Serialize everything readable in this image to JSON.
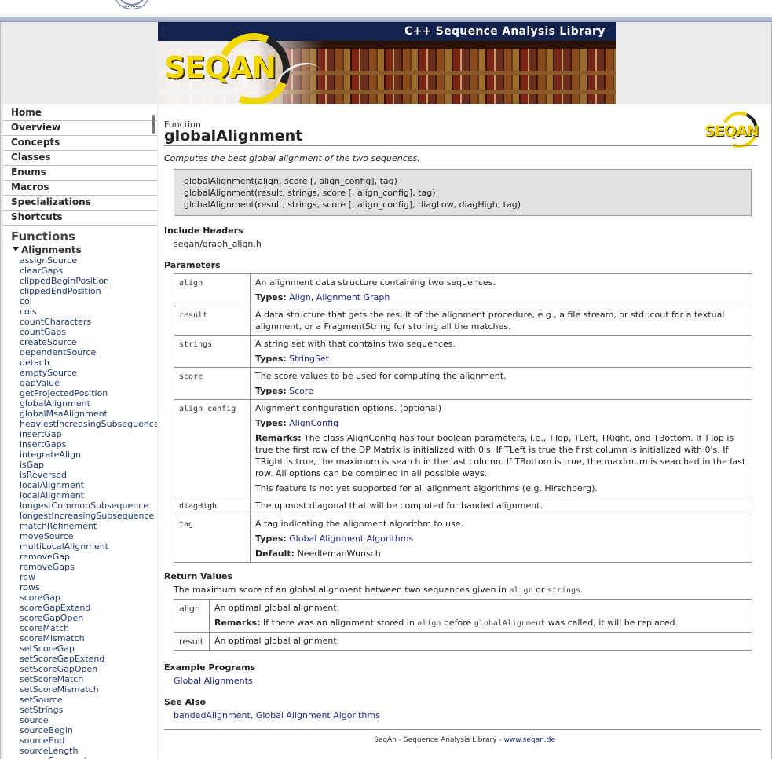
{
  "banner": {
    "title": "C++ Sequence Analysis Library",
    "logo_text": "SEQAN"
  },
  "nav": {
    "items": [
      "Home",
      "Overview",
      "Concepts",
      "Classes",
      "Enums",
      "Macros",
      "Specializations",
      "Shortcuts"
    ],
    "functions_heading": "Functions",
    "group": "Alignments",
    "functions": [
      "assignSource",
      "clearGaps",
      "clippedBeginPosition",
      "clippedEndPosition",
      "col",
      "cols",
      "countCharacters",
      "countGaps",
      "createSource",
      "dependentSource",
      "detach",
      "emptySource",
      "gapValue",
      "getProjectedPosition",
      "globalAlignment",
      "globalMsaAlignment",
      "heaviestIncreasingSubsequence",
      "insertGap",
      "insertGaps",
      "integrateAlign",
      "isGap",
      "isReversed",
      "localAlignment",
      "localAlignment",
      "longestCommonSubsequence",
      "longestIncreasingSubsequence",
      "matchRefinement",
      "moveSource",
      "multiLocalAlignment",
      "removeGap",
      "removeGaps",
      "row",
      "rows",
      "scoreGap",
      "scoreGapExtend",
      "scoreGapOpen",
      "scoreMatch",
      "scoreMismatch",
      "setScoreGap",
      "setScoreGapExtend",
      "setScoreGapOpen",
      "setScoreMatch",
      "setScoreMismatch",
      "setSource",
      "setStrings",
      "source",
      "sourceBegin",
      "sourceEnd",
      "sourceLength",
      "sourceSegment"
    ]
  },
  "doc": {
    "kind": "Function",
    "name": "globalAlignment",
    "logo_text": "SEQAN",
    "brief": "Computes the best global alignment of the two sequences.",
    "signatures": [
      "globalAlignment(align, score [, align_config], tag)",
      "globalAlignment(result, strings, score [, align_config], tag)",
      "globalAlignment(result, strings, score [, align_config], diagLow, diagHigh, tag)"
    ],
    "include_heading": "Include Headers",
    "include_file": "seqan/graph_align.h",
    "params_heading": "Parameters",
    "params": {
      "align": {
        "name": "align",
        "desc": "An alignment data structure containing two sequences.",
        "types_label": "Types:",
        "type1": "Align",
        "sep": ", ",
        "type2": "Alignment Graph"
      },
      "result": {
        "name": "result",
        "desc": "A data structure that gets the result of the alignment procedure, e.g., a file stream, or std::cout for a textual alignment, or a FragmentString for storing all the matches."
      },
      "strings": {
        "name": "strings",
        "desc": "A string set with that contains two sequences.",
        "types_label": "Types:",
        "type1": "StringSet"
      },
      "score": {
        "name": "score",
        "desc": "The score values to be used for computing the alignment.",
        "types_label": "Types:",
        "type1": "Score"
      },
      "align_config": {
        "name": "align_config",
        "desc": "Alignment configuration options. (optional)",
        "types_label": "Types:",
        "type1": "AlignConfig",
        "remarks_label": "Remarks:",
        "remarks": "The class AlignConfig has four boolean parameters, i.e., TTop, TLeft, TRight, and TBottom. If TTop is true the first row of the DP Matrix is initialized with 0's. If TLeft is true the first column is initialized with 0's. If TRight is true, the maximum is search in the last column. If TBottom is true, the maximum is searched in the last row. All options can be combined in all possible ways.",
        "note": "This feature is not yet supported for all alignment algorithms (e.g. Hirschberg)."
      },
      "diagHigh": {
        "name": "diagHigh",
        "desc": "The upmost diagonal that will be computed for banded alignment."
      },
      "tag": {
        "name": "tag",
        "desc": "A tag indicating the alignment algorithm to use.",
        "types_label": "Types:",
        "type1": "Global Alignment Algorithms",
        "default_label": "Default:",
        "default_value": "NeedlemanWunsch"
      }
    },
    "return_heading": "Return Values",
    "return_text_pre": "The maximum score of an global alignment between two sequences given in ",
    "return_code1": "align",
    "return_text_mid": " or ",
    "return_code2": "strings",
    "return_text_end": ".",
    "returns": {
      "align": {
        "name": "align",
        "desc": "An optimal global alignment.",
        "remarks_label": "Remarks:",
        "remarks_pre": " If there was an alignment stored in ",
        "remarks_code1": "align",
        "remarks_mid": " before ",
        "remarks_code2": "globalAlignment",
        "remarks_end": " was called, it will be replaced."
      },
      "result": {
        "name": "result",
        "desc": "An optimal global alignment."
      }
    },
    "examples_heading": "Example Programs",
    "example_link": "Global Alignments",
    "seealso_heading": "See Also",
    "seealso_1": "bandedAlignment",
    "seealso_sep": ", ",
    "seealso_2": "Global Alignment Algorithms",
    "footer_text": "SeqAn - Sequence Analysis Library - ",
    "footer_link": "www.seqan.de"
  }
}
